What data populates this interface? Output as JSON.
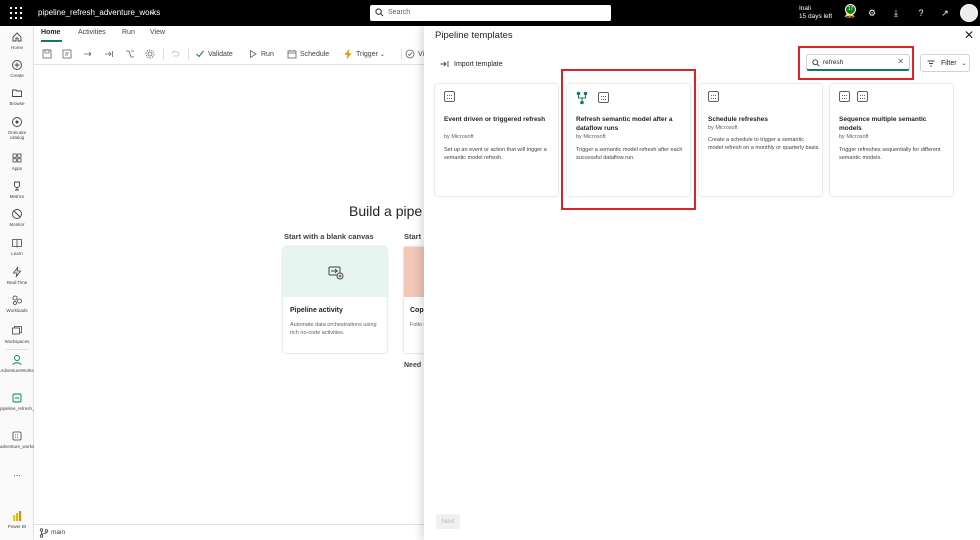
{
  "topbar": {
    "workspace_item": "pipeline_refresh_adventure_works",
    "search_placeholder": "Search",
    "trial_line1": "Inali",
    "trial_line2": "15 days left",
    "notifications_count": "17"
  },
  "leftnav": {
    "items": [
      {
        "label": "Home"
      },
      {
        "label": "Create"
      },
      {
        "label": "Browse"
      },
      {
        "label": "OneLake catalog"
      },
      {
        "label": "Apps"
      },
      {
        "label": "Metrics"
      },
      {
        "label": "Monitor"
      },
      {
        "label": "Learn"
      },
      {
        "label": "Real-Time"
      },
      {
        "label": "Workloads"
      },
      {
        "label": "Workspaces"
      },
      {
        "label": "AdventureWorks"
      },
      {
        "label": "pipeline_refresh_adve..."
      },
      {
        "label": "adventure_works_sales_..."
      },
      {
        "label": "..."
      },
      {
        "label": "Power BI"
      }
    ]
  },
  "ribbon": {
    "tabs": [
      "Home",
      "Activities",
      "Run",
      "View"
    ],
    "validate": "Validate",
    "run": "Run",
    "schedule": "Schedule",
    "trigger": "Trigger",
    "view_trunc": "Vi"
  },
  "canvas": {
    "title": "Build a pipe",
    "blank_heading": "Start with a blank canvas",
    "start_heading": "Start",
    "card_pipeline_title": "Pipeline activity",
    "card_pipeline_desc": "Automate data orchestrations using rich no-code activities.",
    "card_copy_title": "Cop",
    "card_copy_desc": "Follo into othe",
    "need": "Need"
  },
  "status": {
    "branch": "main"
  },
  "panel": {
    "title": "Pipeline templates",
    "import": "Import template",
    "search_value": "refresh",
    "filter": "Filter",
    "next": "Next",
    "templates": [
      {
        "title": "Event driven or triggered refresh",
        "by": "by Microsoft",
        "desc": "Set up an event or action that will trigger a semantic model refresh."
      },
      {
        "title": "Refresh semantic model after a dataflow runs",
        "by": "by Microsoft",
        "desc": "Trigger a semantic model refresh after each successful dataflow run."
      },
      {
        "title": "Schedule refreshes",
        "by": "by Microsoft",
        "desc": "Create a schedule to trigger a semantic model refresh on a monthly or quarterly basis."
      },
      {
        "title": "Sequence multiple semantic models",
        "by": "by Microsoft",
        "desc": "Trigger refreshes sequentially for different semantic models."
      }
    ]
  },
  "colors": {
    "accent": "#117865",
    "highlight": "#d9232b",
    "topbar": "#000000"
  }
}
